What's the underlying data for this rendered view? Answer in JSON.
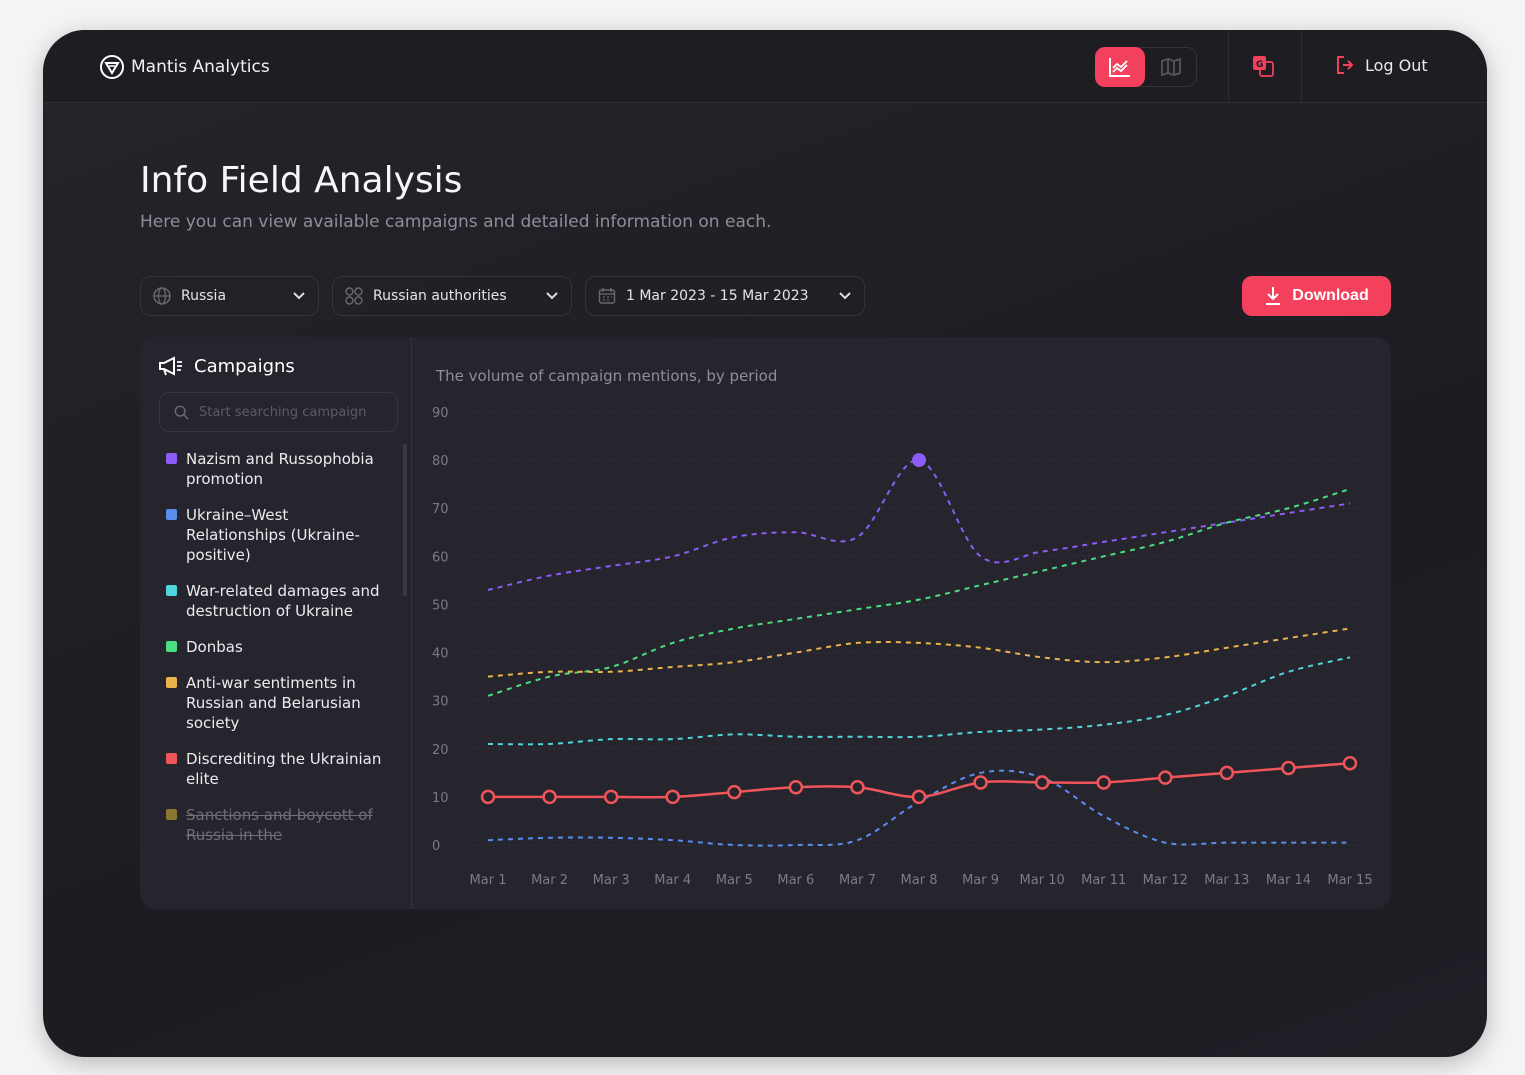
{
  "header": {
    "brand": "Mantis Analytics",
    "logout_label": "Log Out",
    "view_modes": [
      {
        "icon": "chart-icon",
        "active": true
      },
      {
        "icon": "map-icon",
        "active": false
      }
    ],
    "translate_icon": "translate-icon"
  },
  "page": {
    "title": "Info Field Analysis",
    "subtitle": "Here you can view available campaigns and detailed information on each."
  },
  "filters": {
    "country": "Russia",
    "actor": "Russian authorities",
    "date_range": "1 Mar 2023 - 15 Mar 2023"
  },
  "download_label": "Download",
  "accent": "#f2405d",
  "campaigns": {
    "title": "Campaigns",
    "search_placeholder": "Start searching campaign",
    "items": [
      {
        "label": "Nazism and Russophobia promotion",
        "color": "#8b5cf6",
        "enabled": true
      },
      {
        "label": "Ukraine–West Relationships (Ukraine-positive)",
        "color": "#5b8def",
        "enabled": true
      },
      {
        "label": "War-related damages and destruction of Ukraine",
        "color": "#4fd6dc",
        "enabled": true
      },
      {
        "label": "Donbas",
        "color": "#4ade80",
        "enabled": true
      },
      {
        "label": "Anti-war sentiments in Russian and Belarusian society",
        "color": "#e9b44c",
        "enabled": true
      },
      {
        "label": "Discrediting the Ukrainian elite",
        "color": "#f0555a",
        "enabled": true
      },
      {
        "label": "Sanctions and boycott of Russia in the",
        "color": "#8a7630",
        "enabled": false
      }
    ]
  },
  "chart_data": {
    "type": "line",
    "title": "The volume of campaign mentions, by period",
    "categories": [
      "Mar 1",
      "Mar 2",
      "Mar 3",
      "Mar 4",
      "Mar 5",
      "Mar 6",
      "Mar 7",
      "Mar 8",
      "Mar 9",
      "Mar 10",
      "Mar 11",
      "Mar 12",
      "Mar 13",
      "Mar 14",
      "Mar 15"
    ],
    "ylim": [
      0,
      90
    ],
    "yticks": [
      0,
      10,
      20,
      30,
      40,
      50,
      60,
      70,
      80,
      90
    ],
    "grid": true,
    "series": [
      {
        "name": "Nazism and Russophobia promotion",
        "color": "#8b5cf6",
        "style": "dashed",
        "values": [
          53,
          56,
          58,
          60,
          64,
          65,
          64,
          80,
          60,
          61,
          63,
          65,
          67,
          69,
          71
        ]
      },
      {
        "name": "Ukraine–West Relationships (Ukraine-positive)",
        "color": "#5b8def",
        "style": "dashed",
        "values": [
          1,
          1.5,
          1.5,
          1,
          0,
          0,
          1,
          9,
          15,
          14,
          6,
          0.5,
          0.5,
          0.5,
          0.5
        ]
      },
      {
        "name": "War-related damages and destruction of Ukraine",
        "color": "#4fd6dc",
        "style": "dashed",
        "values": [
          21,
          21,
          22,
          22,
          23,
          22.5,
          22.5,
          22.5,
          23.5,
          24,
          25,
          27,
          31,
          36,
          39
        ]
      },
      {
        "name": "Donbas",
        "color": "#4ade80",
        "style": "dashed",
        "values": [
          31,
          35,
          37,
          42,
          45,
          47,
          49,
          51,
          54,
          57,
          60,
          63,
          67,
          70,
          74
        ]
      },
      {
        "name": "Anti-war sentiments in Russian and Belarusian society",
        "color": "#e9b44c",
        "style": "dashed",
        "values": [
          35,
          36,
          36,
          37,
          38,
          40,
          42,
          42,
          41,
          39,
          38,
          39,
          41,
          43,
          45
        ]
      },
      {
        "name": "Discrediting the Ukrainian elite",
        "color": "#f0555a",
        "style": "solid",
        "markers": true,
        "values": [
          10,
          10,
          10,
          10,
          11,
          12,
          12,
          10,
          13,
          13,
          13,
          14,
          15,
          16,
          17
        ]
      }
    ],
    "highlight": {
      "series": "Nazism and Russophobia promotion",
      "category": "Mar 8",
      "value": 80
    }
  }
}
